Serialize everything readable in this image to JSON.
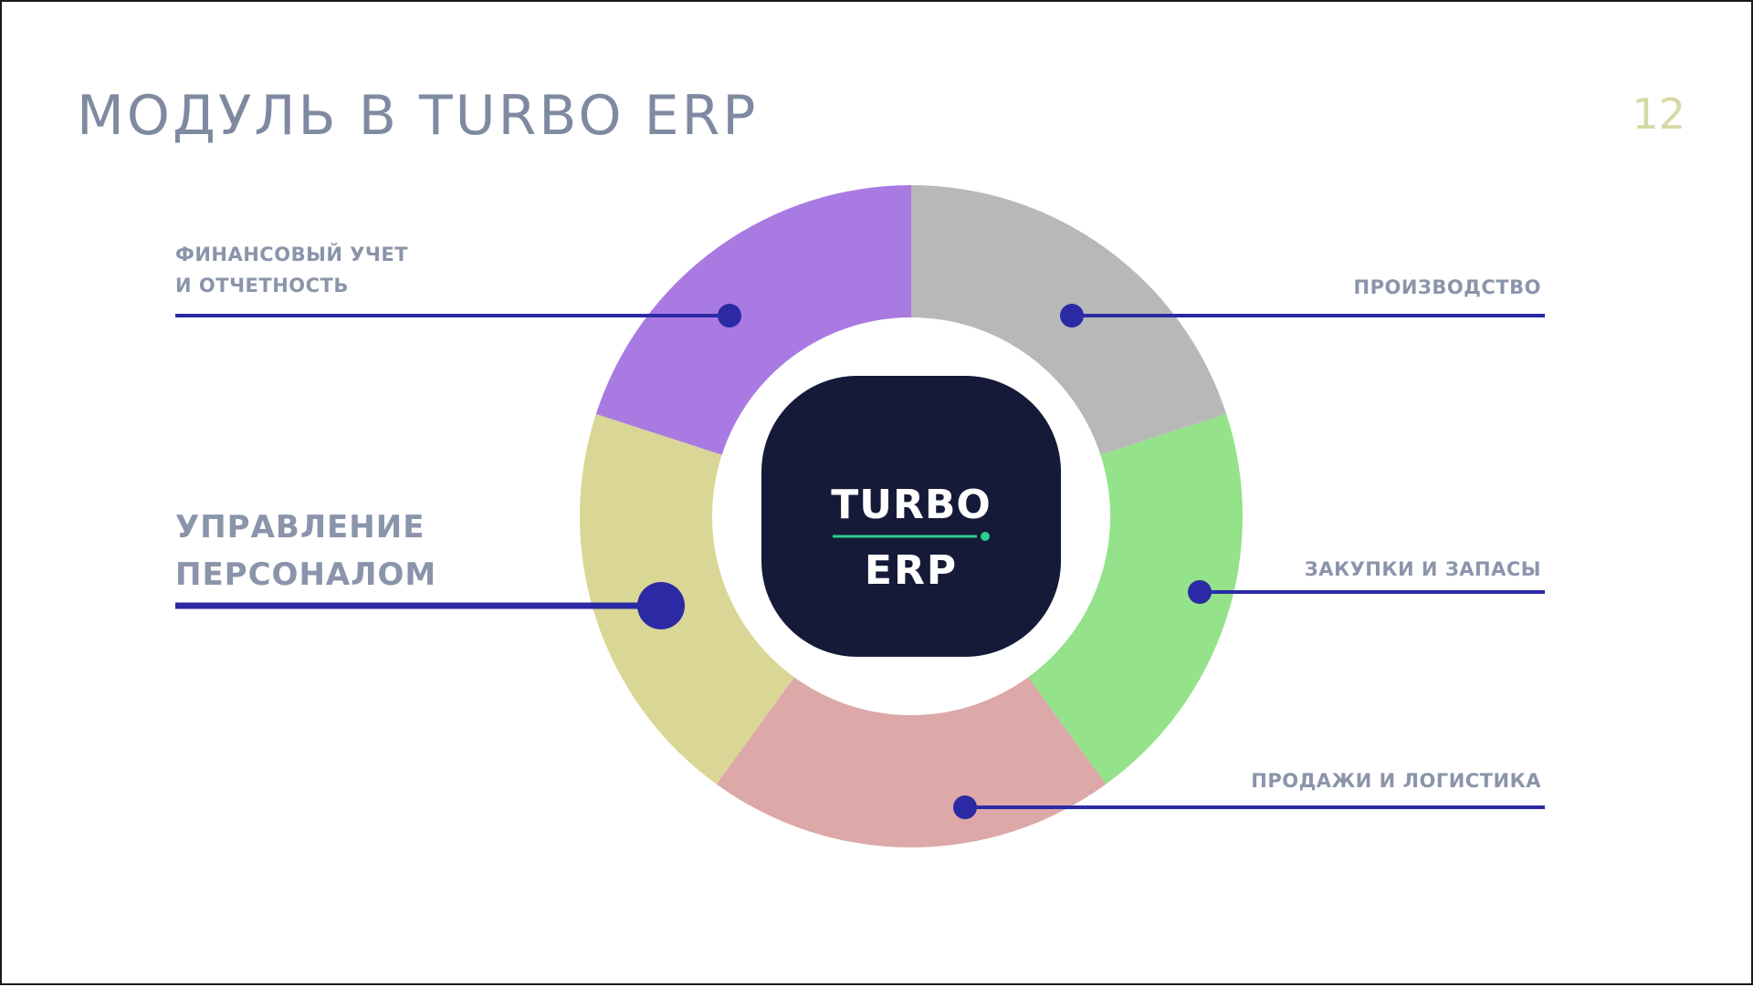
{
  "slide": {
    "title": "МОДУЛЬ В TURBO ERP",
    "page_number": "12"
  },
  "center_logo": {
    "line1": "TURBO",
    "line2": "ERP",
    "background": "#151a38",
    "accent": "#2bd08a"
  },
  "segments": [
    {
      "id": "production",
      "lines": [
        "ПРОИЗВОДСТВО"
      ],
      "color": "#b8b8b8",
      "highlighted": false
    },
    {
      "id": "purchasing",
      "lines": [
        "ЗАКУПКИ И ЗАПАСЫ"
      ],
      "color": "#94e28a",
      "highlighted": false
    },
    {
      "id": "sales",
      "lines": [
        "ПРОДАЖИ И ЛОГИСТИКА"
      ],
      "color": "#dca8a8",
      "highlighted": false
    },
    {
      "id": "hr",
      "lines": [
        "УПРАВЛЕНИЕ",
        "ПЕРСОНАЛОМ"
      ],
      "color": "#dad695",
      "highlighted": true
    },
    {
      "id": "finance",
      "lines": [
        "ФИНАНСОВЫЙ УЧЕТ",
        "И ОТЧЕТНОСТЬ"
      ],
      "color": "#aa7ae3",
      "highlighted": false
    }
  ],
  "colors": {
    "connector": "#2b2aa4",
    "label_text": "#8a94aa",
    "title_text": "#7f8aa1",
    "page_number_text": "#d6d9a4"
  }
}
